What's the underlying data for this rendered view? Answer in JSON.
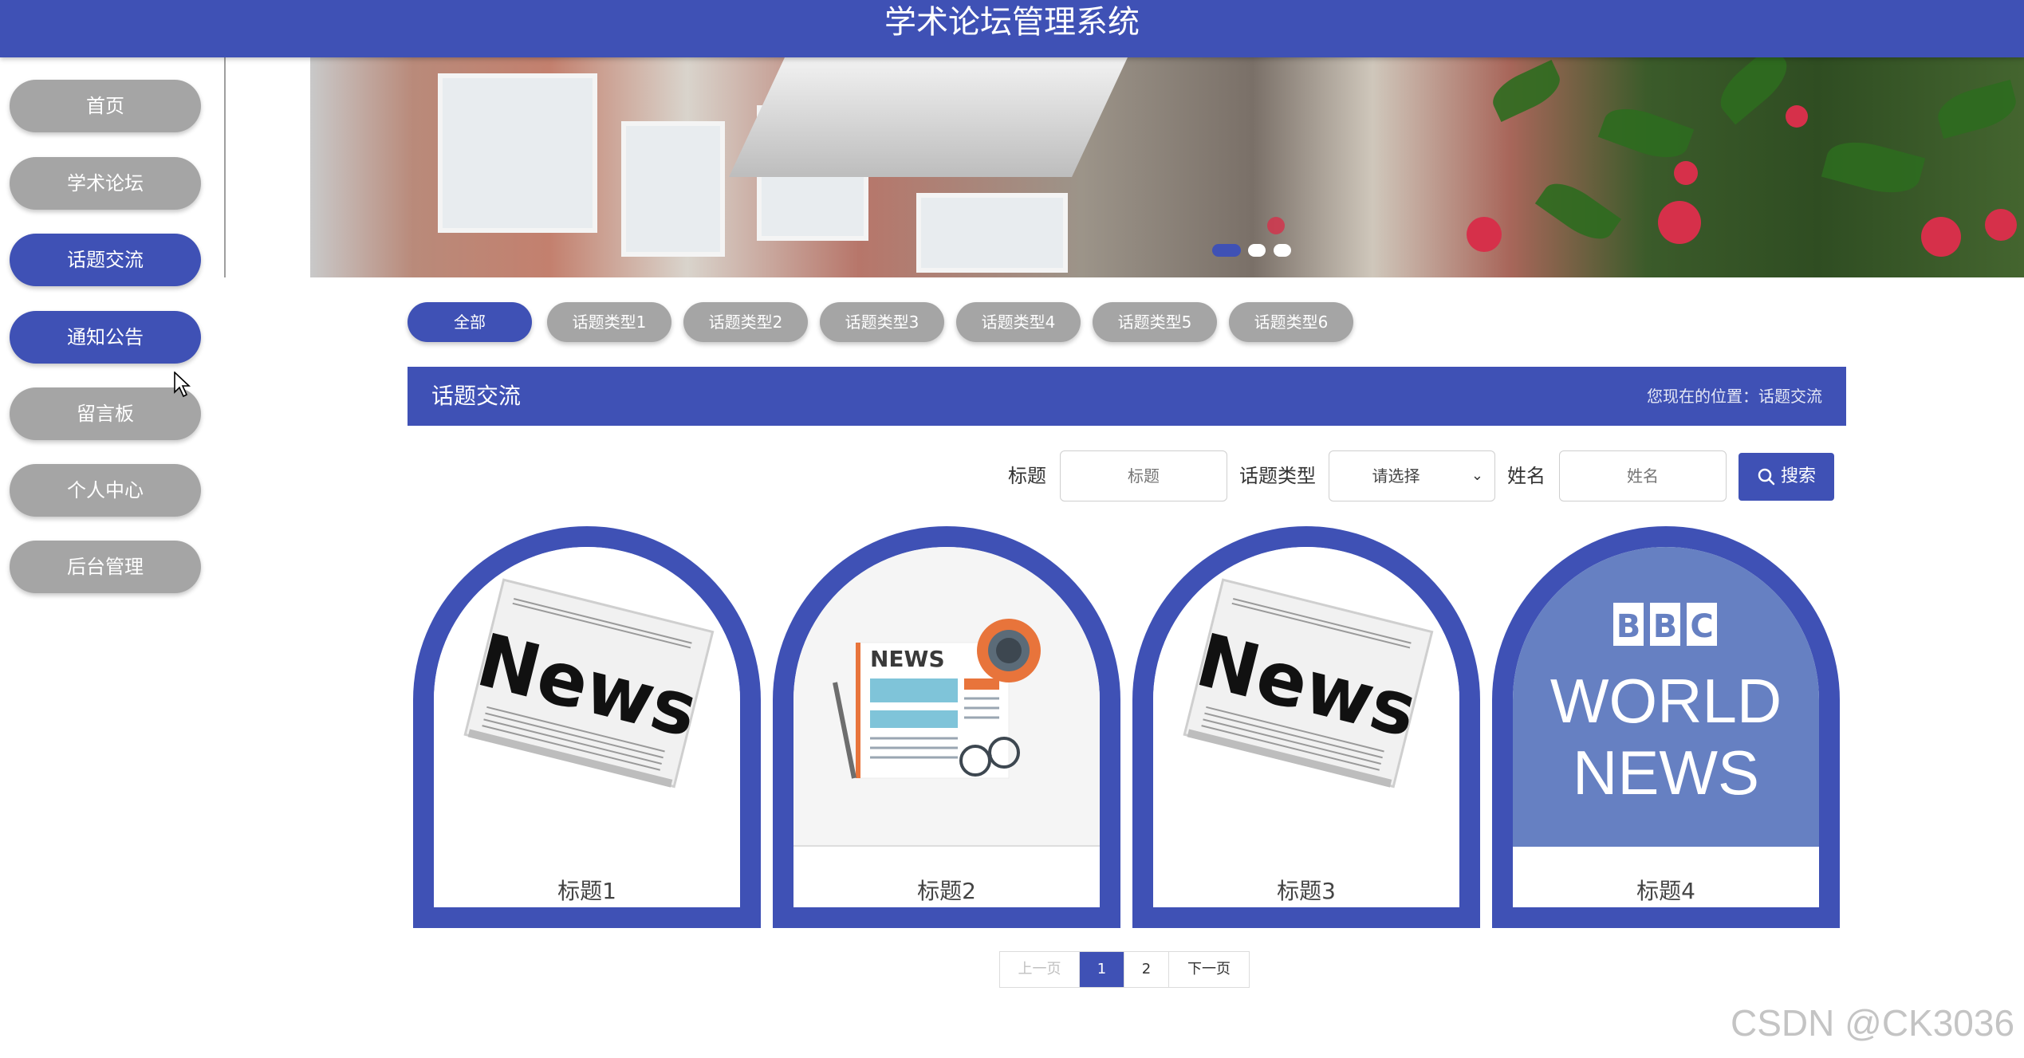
{
  "header": {
    "title": "学术论坛管理系统"
  },
  "sidebar": {
    "items": [
      {
        "label": "首页",
        "active": false
      },
      {
        "label": "学术论坛",
        "active": false
      },
      {
        "label": "话题交流",
        "active": true
      },
      {
        "label": "通知公告",
        "active": true
      },
      {
        "label": "留言板",
        "active": false
      },
      {
        "label": "个人中心",
        "active": false
      },
      {
        "label": "后台管理",
        "active": false
      }
    ]
  },
  "banner": {
    "slides": 3,
    "active_slide": 1
  },
  "tabs": [
    {
      "label": "全部",
      "active": true
    },
    {
      "label": "话题类型1",
      "active": false
    },
    {
      "label": "话题类型2",
      "active": false
    },
    {
      "label": "话题类型3",
      "active": false
    },
    {
      "label": "话题类型4",
      "active": false
    },
    {
      "label": "话题类型5",
      "active": false
    },
    {
      "label": "话题类型6",
      "active": false
    }
  ],
  "section": {
    "title": "话题交流",
    "location": "您现在的位置：话题交流"
  },
  "search": {
    "title_label": "标题",
    "title_placeholder": "标题",
    "type_label": "话题类型",
    "type_value": "请选择",
    "name_label": "姓名",
    "name_placeholder": "姓名",
    "button_label": "搜索"
  },
  "cards": [
    {
      "title": "标题1",
      "image": "news-newspaper"
    },
    {
      "title": "标题2",
      "image": "news-flat-illustration"
    },
    {
      "title": "标题3",
      "image": "news-newspaper"
    },
    {
      "title": "标题4",
      "image": "bbc-world-news"
    }
  ],
  "images": {
    "newspaper_text": "News",
    "flat_news_text": "NEWS",
    "bbc_letters": [
      "B",
      "B",
      "C"
    ],
    "bbc_line1": "WORLD",
    "bbc_line2": "NEWS"
  },
  "pagination": {
    "prev": "上一页",
    "pages": [
      "1",
      "2"
    ],
    "current": "1",
    "next": "下一页"
  },
  "watermark": "CSDN @CK3036",
  "colors": {
    "primary": "#3f51b5",
    "inactive": "#a5a5a5",
    "bbc_bg": "#6680c2"
  }
}
